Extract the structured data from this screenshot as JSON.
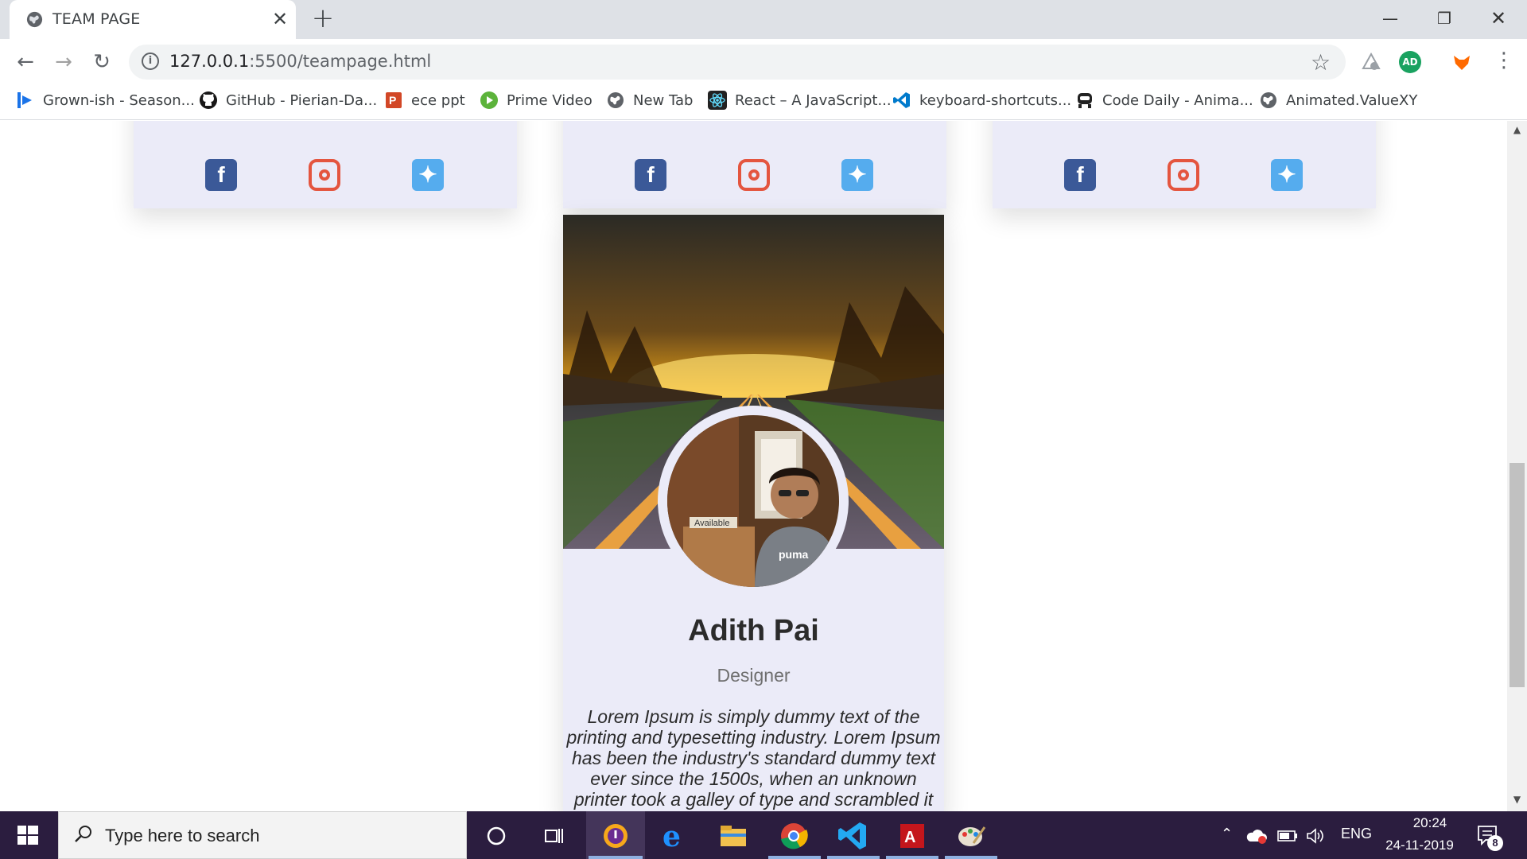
{
  "browser": {
    "tab_title": "TEAM PAGE",
    "url_host": "127.0.0.1",
    "url_rest": ":5500/teampage.html",
    "profile_initials": "AD"
  },
  "bookmarks": [
    {
      "label": "Grown-ish - Season...",
      "icon": "play-icon",
      "color": "#1a73e8"
    },
    {
      "label": "GitHub - Pierian-Da...",
      "icon": "github-icon",
      "color": "#181717"
    },
    {
      "label": "ece ppt",
      "icon": "powerpoint-icon",
      "color": "#d24726"
    },
    {
      "label": "Prime Video",
      "icon": "prime-video-icon",
      "color": "#5cb33b"
    },
    {
      "label": "New Tab",
      "icon": "globe-icon",
      "color": "#5f6368"
    },
    {
      "label": "React – A JavaScript...",
      "icon": "react-icon",
      "color": "#222222"
    },
    {
      "label": "keyboard-shortcuts...",
      "icon": "vscode-icon",
      "color": "#007acc"
    },
    {
      "label": "Code Daily - Anima...",
      "icon": "code-daily-icon",
      "color": "#222222"
    },
    {
      "label": "Animated.ValueXY",
      "icon": "globe-icon",
      "color": "#5f6368"
    }
  ],
  "member": {
    "name": "Adith Pai",
    "role": "Designer",
    "bio": "Lorem Ipsum is simply dummy text of the printing and typesetting industry. Lorem Ipsum has been the industry's standard dummy text ever since the 1500s, when an unknown printer took a galley of type and scrambled it to make a"
  },
  "taskbar": {
    "search_placeholder": "Type here to search",
    "language": "ENG",
    "time": "20:24",
    "date": "24-11-2019",
    "notification_count": "8"
  },
  "colors": {
    "card_bg": "#ebebf8",
    "facebook": "#3b5998",
    "instagram": "#e4553f",
    "twitter": "#55acee",
    "taskbar": "#2b1d3f"
  }
}
